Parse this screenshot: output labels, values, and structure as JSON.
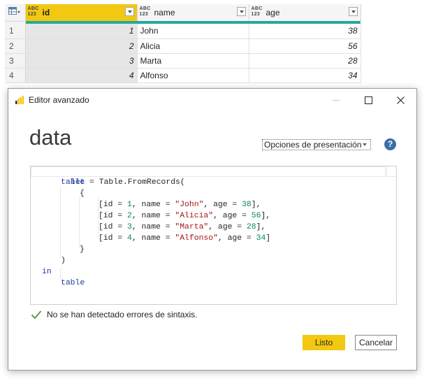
{
  "table": {
    "columns": [
      {
        "type_line1": "ABC",
        "type_line2": "123",
        "name": "id"
      },
      {
        "type_line1": "ABC",
        "type_line2": "123",
        "name": "name"
      },
      {
        "type_line1": "ABC",
        "type_line2": "123",
        "name": "age"
      }
    ],
    "rows": [
      {
        "num": "1",
        "id": "1",
        "name": "John",
        "age": "38"
      },
      {
        "num": "2",
        "id": "2",
        "name": "Alicia",
        "age": "56"
      },
      {
        "num": "3",
        "id": "3",
        "name": "Marta",
        "age": "28"
      },
      {
        "num": "4",
        "id": "4",
        "name": "Alfonso",
        "age": "34"
      }
    ],
    "accent_color": "#2aa79b",
    "selected_column_color": "#f2c811"
  },
  "dialog": {
    "title": "Editor avanzado",
    "query_name": "data",
    "display_options": "Opciones de presentación",
    "help": "?",
    "code": {
      "let": "let",
      "in": "in",
      "table_ident": "table",
      "eq_call": " = Table.FromRecords(",
      "open_brace": "{",
      "close_brace": "}",
      "close_paren": ")",
      "records": [
        {
          "pre": "[id = ",
          "id": "1",
          "mid1": ", name = ",
          "name": "\"John\"",
          "mid2": ", age = ",
          "age": "38",
          "post": "],"
        },
        {
          "pre": "[id = ",
          "id": "2",
          "mid1": ", name = ",
          "name": "\"Alicia\"",
          "mid2": ", age = ",
          "age": "56",
          "post": "],"
        },
        {
          "pre": "[id = ",
          "id": "3",
          "mid1": ", name = ",
          "name": "\"Marta\"",
          "mid2": ", age = ",
          "age": "28",
          "post": "],"
        },
        {
          "pre": "[id = ",
          "id": "4",
          "mid1": ", name = ",
          "name": "\"Alfonso\"",
          "mid2": ", age = ",
          "age": "34",
          "post": "]"
        }
      ],
      "result": "table"
    },
    "status": "No se han detectado errores de sintaxis.",
    "ok_button": "Listo",
    "cancel_button": "Cancelar"
  }
}
